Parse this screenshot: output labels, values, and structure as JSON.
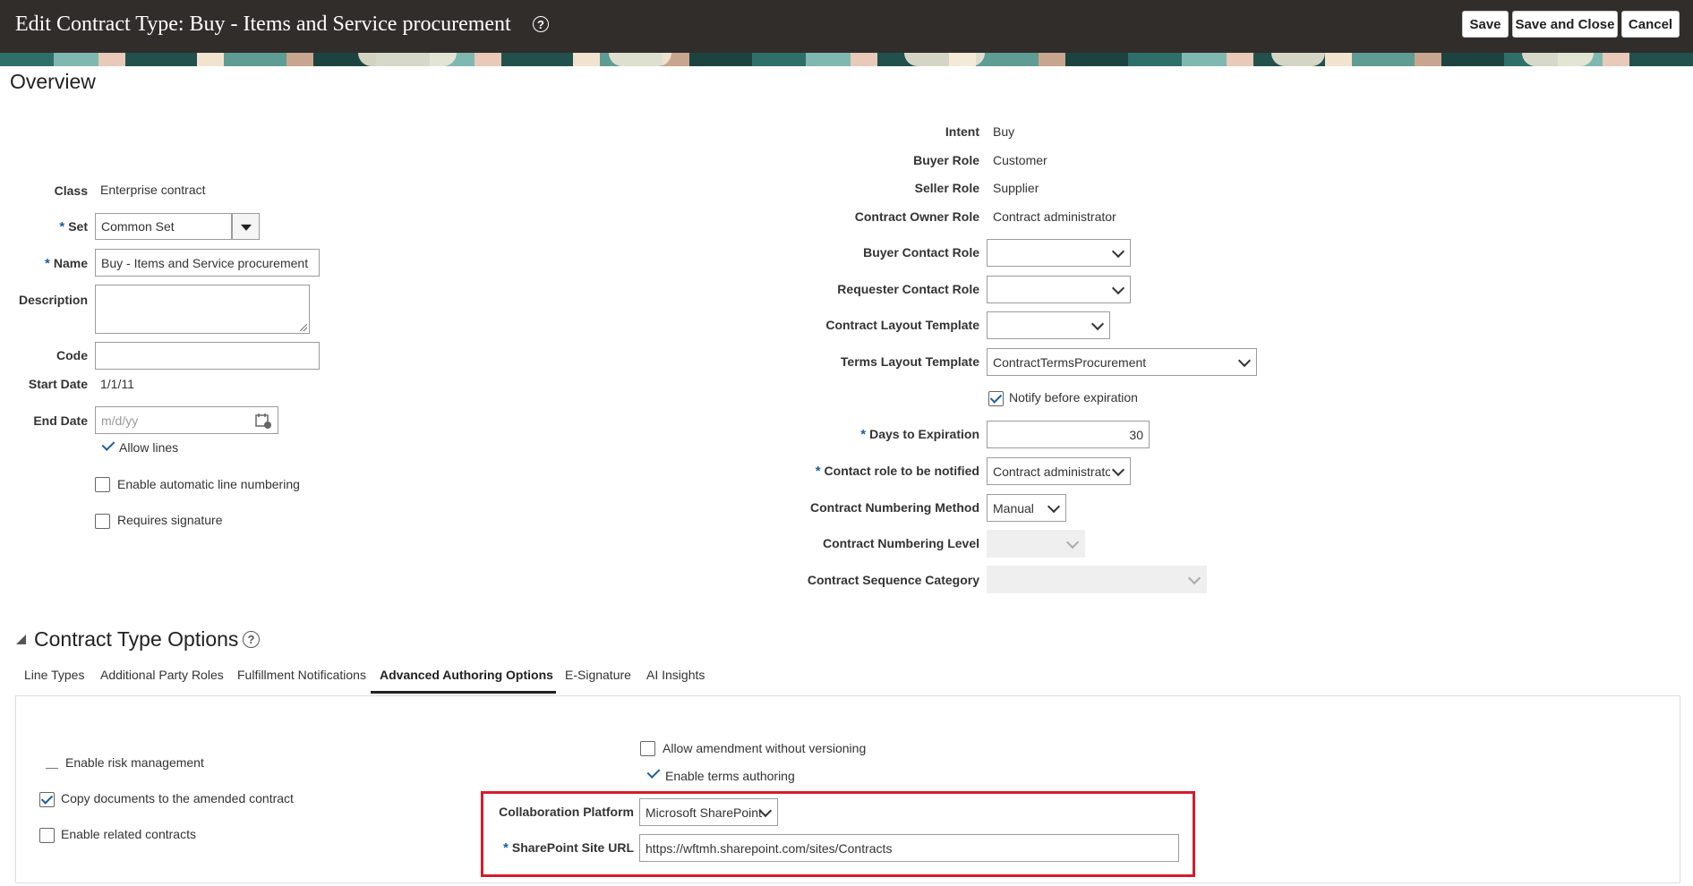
{
  "header": {
    "title": "Edit Contract Type: Buy - Items and Service procurement",
    "help_icon": "?",
    "save_label": "Save",
    "save_close_label": "Save and Close",
    "cancel_label": "Cancel"
  },
  "overview": {
    "title": "Overview",
    "left": {
      "class_label": "Class",
      "class_value": "Enterprise contract",
      "set_label": "Set",
      "set_value": "Common Set",
      "name_label": "Name",
      "name_value": "Buy - Items and Service procurement",
      "description_label": "Description",
      "description_value": "",
      "code_label": "Code",
      "code_value": "",
      "start_date_label": "Start Date",
      "start_date_value": "1/1/11",
      "end_date_label": "End Date",
      "end_date_placeholder": "m/d/yy",
      "allow_lines": "Allow lines",
      "enable_auto_numbering": "Enable automatic line numbering",
      "requires_signature": "Requires signature"
    },
    "right": {
      "intent_label": "Intent",
      "intent_value": "Buy",
      "buyer_role_label": "Buyer Role",
      "buyer_role_value": "Customer",
      "seller_role_label": "Seller Role",
      "seller_role_value": "Supplier",
      "owner_role_label": "Contract Owner Role",
      "owner_role_value": "Contract administrator",
      "buyer_contact_label": "Buyer Contact Role",
      "buyer_contact_value": "",
      "requester_contact_label": "Requester Contact Role",
      "requester_contact_value": "",
      "layout_template_label": "Contract Layout Template",
      "layout_template_value": "",
      "terms_template_label": "Terms Layout Template",
      "terms_template_value": "ContractTermsProcurement",
      "notify_label": "Notify before expiration",
      "days_label": "Days to Expiration",
      "days_value": "30",
      "contact_notified_label": "Contact role to be notified",
      "contact_notified_value": "Contract administrator",
      "numbering_method_label": "Contract Numbering Method",
      "numbering_method_value": "Manual",
      "numbering_level_label": "Contract Numbering Level",
      "numbering_level_value": "",
      "sequence_category_label": "Contract Sequence Category",
      "sequence_category_value": ""
    }
  },
  "options": {
    "title": "Contract Type Options",
    "tabs": [
      {
        "label": "Line Types"
      },
      {
        "label": "Additional Party Roles"
      },
      {
        "label": "Fulfillment Notifications"
      },
      {
        "label": "Advanced Authoring Options"
      },
      {
        "label": "E-Signature"
      },
      {
        "label": "AI Insights"
      }
    ],
    "panel": {
      "enable_risk": "Enable risk management",
      "copy_documents": "Copy documents to the amended contract",
      "enable_related": "Enable related contracts",
      "allow_amendment": "Allow amendment without versioning",
      "enable_terms": "Enable terms authoring",
      "collab_platform_label": "Collaboration Platform",
      "collab_platform_value": "Microsoft SharePoint",
      "sharepoint_url_label": "SharePoint Site URL",
      "sharepoint_url_value": "https://wftmh.sharepoint.com/sites/Contracts"
    }
  },
  "colors": {
    "header_bg": "#312d2a",
    "accent": "#1c5f9c",
    "highlight": "#d41c2b"
  }
}
